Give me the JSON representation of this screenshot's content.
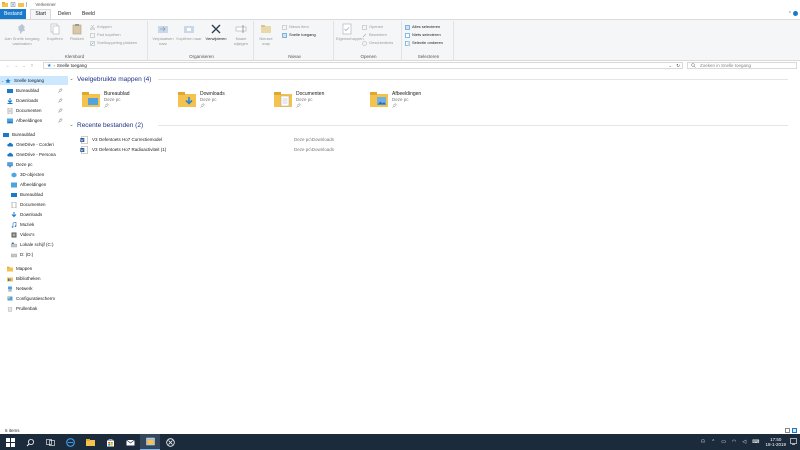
{
  "window": {
    "title": "Verkenner",
    "title_sep": "|"
  },
  "tabs": {
    "file": "Bestand",
    "start": "Start",
    "share": "Delen",
    "view": "Beeld"
  },
  "ribbon": {
    "clipboard": {
      "pin_label": "Aan Snelle toegang vastmaken",
      "copy_label": "Kopiëren",
      "paste_label": "Plakken",
      "cut_label": "Knippen",
      "copy_path_label": "Pad kopiëren",
      "paste_shortcut_label": "Snelkoppeling plakken",
      "group_name": "Klembord"
    },
    "organize": {
      "move_label": "Verplaatsen naar",
      "copy_to_label": "Kopiëren naar",
      "delete_label": "Verwijderen",
      "rename_label": "Naam wijzigen",
      "group_name": "Organiseren"
    },
    "new": {
      "new_folder_label": "Nieuwe map",
      "new_item_label": "Nieuw item",
      "easy_access_label": "Snelle toegang",
      "group_name": "Nieuw"
    },
    "open": {
      "properties_label": "Eigenschappen",
      "open_label": "Openen",
      "edit_label": "Bewerken",
      "history_label": "Geschiedenis",
      "group_name": "Openen"
    },
    "select": {
      "select_all_label": "Alles selecteren",
      "select_none_label": "Niets selecteren",
      "invert_label": "Selectie omkeren",
      "group_name": "Selecteren"
    }
  },
  "address": {
    "path": "Snelle toegang",
    "search_placeholder": "Zoeken in Snelle toegang"
  },
  "navpane": {
    "quick_access": "Snelle toegang",
    "pinned": [
      {
        "label": "Bureaublad"
      },
      {
        "label": "Downloads"
      },
      {
        "label": "Documenten"
      },
      {
        "label": "Afbeeldingen"
      }
    ],
    "desktop_root": "Bureaublad",
    "onedrive1": "OneDrive - Corderi",
    "onedrive2": "OneDrive - Persona",
    "this_pc": "Deze pc",
    "pc_items": [
      {
        "label": "3D-objecten"
      },
      {
        "label": "Afbeeldingen"
      },
      {
        "label": "Bureaublad"
      },
      {
        "label": "Documenten"
      },
      {
        "label": "Downloads"
      },
      {
        "label": "Muziek"
      },
      {
        "label": "Video's"
      },
      {
        "label": "Lokale schijf (C:)"
      },
      {
        "label": "D: (D:)"
      }
    ],
    "mappen": "Mappen",
    "libraries": "Bibliotheken",
    "network": "Netwerk",
    "control_panel": "Configuratiescherm",
    "recycle_bin": "Prullenbak"
  },
  "content": {
    "frequent_title": "Veelgebruikte mappen (4)",
    "frequent": [
      {
        "name": "Bureaublad",
        "sub": "Deze pc",
        "color": "#4fa3e0"
      },
      {
        "name": "Downloads",
        "sub": "Deze pc",
        "color": "#2a86d1"
      },
      {
        "name": "Documenten",
        "sub": "Deze pc",
        "color": "#a8a8a8"
      },
      {
        "name": "Afbeeldingen",
        "sub": "Deze pc",
        "color": "#6db1e8"
      }
    ],
    "recent_title": "Recente bestanden (2)",
    "recent": [
      {
        "name": "V3 Oefentoets Ho7 Correctiemodel",
        "location": "Deze pc\\Downloads"
      },
      {
        "name": "V3 Oefentoets Ho7 Radioactiviteit (1)",
        "location": "Deze pc\\Downloads"
      }
    ]
  },
  "status": {
    "items": "6 items"
  },
  "taskbar": {
    "time": "17:50",
    "date": "18-1-2019"
  },
  "colors": {
    "accent": "#1979ca",
    "folder_yellow": "#f4c24d",
    "selection": "#cce8ff",
    "taskbar": "#1b2b3c"
  }
}
